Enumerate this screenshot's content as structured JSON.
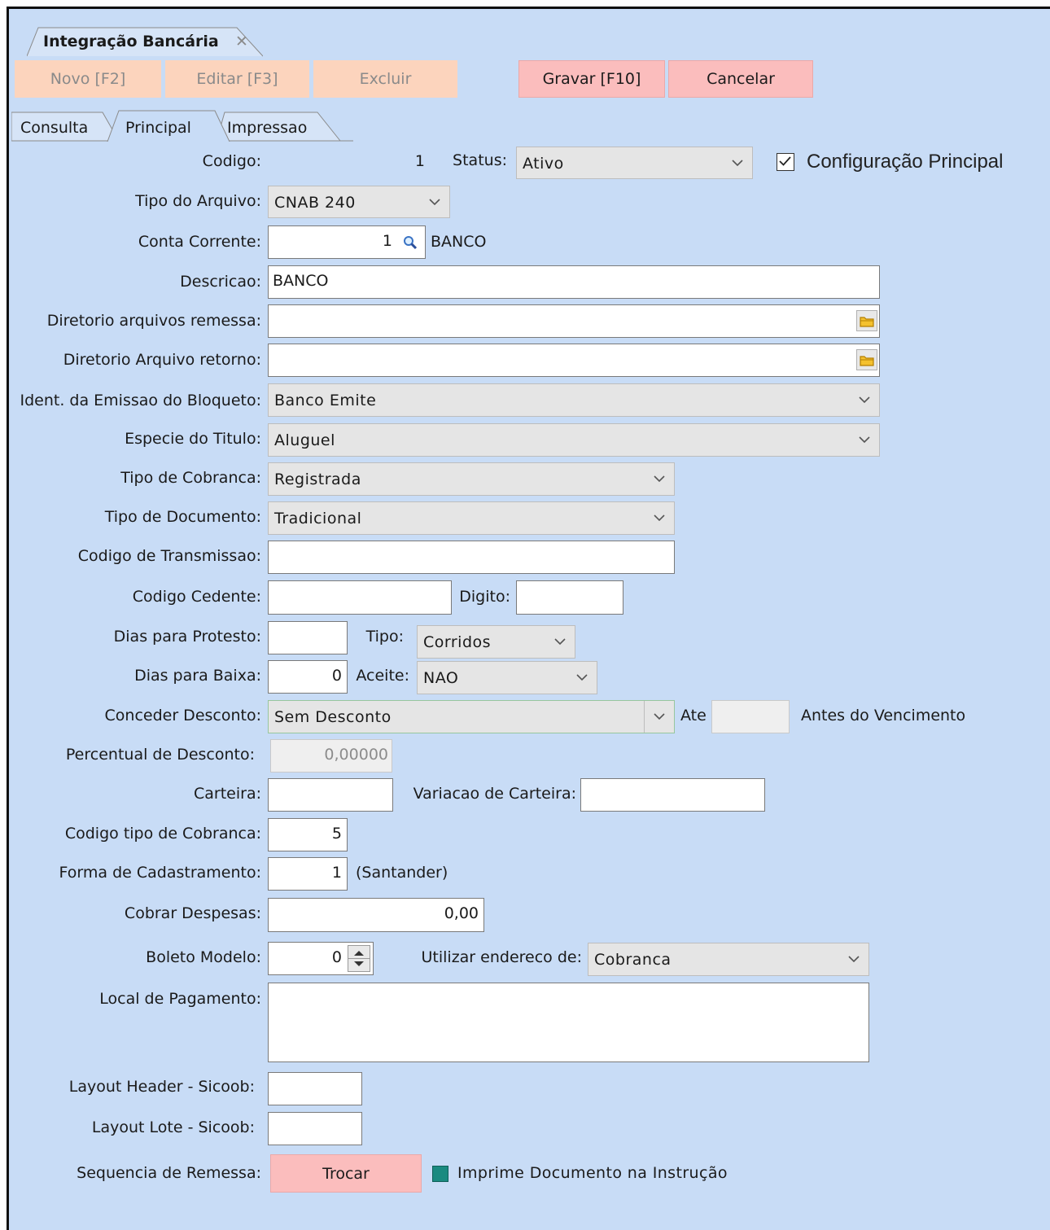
{
  "window_tab": {
    "title": "Integração Bancária",
    "close": "✕"
  },
  "toolbar": {
    "novo": "Novo [F2]",
    "editar": "Editar [F3]",
    "excluir": "Excluir",
    "gravar": "Gravar [F10]",
    "cancelar": "Cancelar"
  },
  "tabs": {
    "consulta": "Consulta",
    "principal": "Principal",
    "impressao": "Impressao",
    "active": "Principal"
  },
  "form": {
    "codigo": {
      "label": "Codigo:",
      "value": "1"
    },
    "status": {
      "label": "Status:",
      "value": "Ativo"
    },
    "config_principal": {
      "label": "Configuração Principal",
      "checked": true
    },
    "tipo_arquivo": {
      "label": "Tipo do Arquivo:",
      "value": "CNAB 240"
    },
    "conta_corrente": {
      "label": "Conta Corrente:",
      "value": "1",
      "name": "BANCO"
    },
    "descricao": {
      "label": "Descricao:",
      "value": "BANCO"
    },
    "dir_remessa": {
      "label": "Diretorio arquivos remessa:",
      "value": ""
    },
    "dir_retorno": {
      "label": "Diretorio Arquivo retorno:",
      "value": ""
    },
    "ident_emissao": {
      "label": "Ident. da Emissao do Bloqueto:",
      "value": "Banco Emite"
    },
    "especie_titulo": {
      "label": "Especie do Titulo:",
      "value": "Aluguel"
    },
    "tipo_cobranca": {
      "label": "Tipo de Cobranca:",
      "value": "Registrada"
    },
    "tipo_documento": {
      "label": "Tipo de Documento:",
      "value": "Tradicional"
    },
    "codigo_transmissao": {
      "label": "Codigo de Transmissao:",
      "value": ""
    },
    "codigo_cedente": {
      "label": "Codigo Cedente:",
      "value": ""
    },
    "digito": {
      "label": "Digito:",
      "value": ""
    },
    "dias_protesto": {
      "label": "Dias para Protesto:",
      "value": ""
    },
    "tipo": {
      "label": "Tipo:",
      "value": "Corridos"
    },
    "dias_baixa": {
      "label": "Dias para Baixa:",
      "value": "0"
    },
    "aceite": {
      "label": "Aceite:",
      "value": "NAO"
    },
    "conceder_desconto": {
      "label": "Conceder Desconto:",
      "value": "Sem Desconto",
      "ate": "Ate",
      "ate_value": "",
      "suffix": "Antes do Vencimento"
    },
    "percentual_desconto": {
      "label": "Percentual de Desconto:",
      "value": "0,00000"
    },
    "carteira": {
      "label": "Carteira:",
      "value": ""
    },
    "variacao_carteira": {
      "label": "Variacao de Carteira:",
      "value": ""
    },
    "codigo_tipo_cobranca": {
      "label": "Codigo tipo de Cobranca:",
      "value": "5"
    },
    "forma_cadastramento": {
      "label": "Forma de Cadastramento:",
      "value": "1",
      "suffix": "(Santander)"
    },
    "cobrar_despesas": {
      "label": "Cobrar Despesas:",
      "value": "0,00"
    },
    "boleto_modelo": {
      "label": "Boleto Modelo:",
      "value": "0"
    },
    "utilizar_endereco": {
      "label": "Utilizar endereco de:",
      "value": "Cobranca"
    },
    "local_pagamento": {
      "label": "Local de Pagamento:",
      "value": ""
    },
    "layout_header": {
      "label": "Layout Header - Sicoob:",
      "value": ""
    },
    "layout_lote": {
      "label": "Layout Lote - Sicoob:",
      "value": ""
    },
    "sequencia_remessa": {
      "label": "Sequencia de Remessa:",
      "button": "Trocar"
    },
    "imprime_documento": {
      "label": "Imprime Documento na Instrução",
      "checked": true
    }
  },
  "colors": {
    "background": "#c8dcf6",
    "button_disabled": "#fcd4bd",
    "button_active": "#fbbdbd",
    "checkbox_fill": "#1a8a80"
  },
  "icons": {
    "lookup": "magnifier-icon",
    "folder": "folder-icon",
    "dropdown": "chevron-down-icon",
    "spinner": "spin-arrows-icon"
  }
}
